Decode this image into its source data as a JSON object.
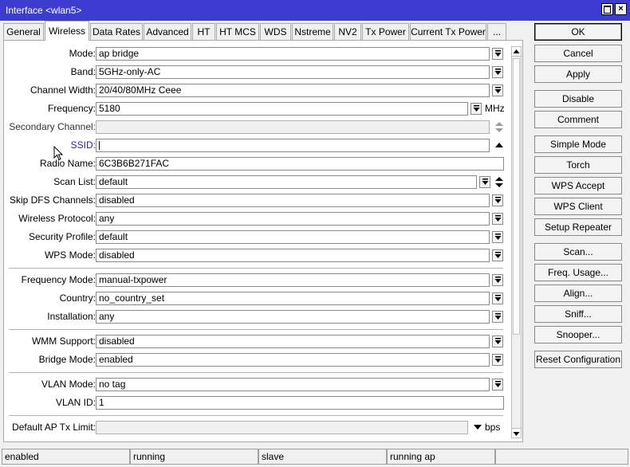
{
  "window": {
    "title": "Interface <wlan5>",
    "maximize_label": "",
    "close_label": "×",
    "titlebar_color": "#3c3cd0"
  },
  "tabs": [
    {
      "label": "General",
      "active": false
    },
    {
      "label": "Wireless",
      "active": true
    },
    {
      "label": "Data Rates",
      "active": false
    },
    {
      "label": "Advanced",
      "active": false
    },
    {
      "label": "HT",
      "active": false
    },
    {
      "label": "HT MCS",
      "active": false
    },
    {
      "label": "WDS",
      "active": false
    },
    {
      "label": "Nstreme",
      "active": false
    },
    {
      "label": "NV2",
      "active": false
    },
    {
      "label": "Tx Power",
      "active": false
    },
    {
      "label": "Current Tx Power",
      "active": false
    },
    {
      "label": "...",
      "active": false
    }
  ],
  "form": {
    "mode": {
      "label": "Mode:",
      "value": "ap bridge"
    },
    "band": {
      "label": "Band:",
      "value": "5GHz-only-AC"
    },
    "channel_width": {
      "label": "Channel Width:",
      "value": "20/40/80MHz Ceee"
    },
    "frequency": {
      "label": "Frequency:",
      "value": "5180",
      "unit": "MHz"
    },
    "secondary_channel": {
      "label": "Secondary Channel:",
      "value": ""
    },
    "ssid": {
      "label": "SSID:",
      "value": ""
    },
    "radio_name": {
      "label": "Radio Name:",
      "value": "6C3B6B271FAC"
    },
    "scan_list": {
      "label": "Scan List:",
      "value": "default"
    },
    "skip_dfs": {
      "label": "Skip DFS Channels:",
      "value": "disabled"
    },
    "wireless_protocol": {
      "label": "Wireless Protocol:",
      "value": "any"
    },
    "security_profile": {
      "label": "Security Profile:",
      "value": "default"
    },
    "wps_mode": {
      "label": "WPS Mode:",
      "value": "disabled"
    },
    "frequency_mode": {
      "label": "Frequency Mode:",
      "value": "manual-txpower"
    },
    "country": {
      "label": "Country:",
      "value": "no_country_set"
    },
    "installation": {
      "label": "Installation:",
      "value": "any"
    },
    "wmm_support": {
      "label": "WMM Support:",
      "value": "disabled"
    },
    "bridge_mode": {
      "label": "Bridge Mode:",
      "value": "enabled"
    },
    "vlan_mode": {
      "label": "VLAN Mode:",
      "value": "no tag"
    },
    "vlan_id": {
      "label": "VLAN ID:",
      "value": "1"
    },
    "default_ap_tx_limit": {
      "label": "Default AP Tx Limit:",
      "value": "",
      "unit": "bps"
    }
  },
  "buttons": [
    {
      "label": "OK"
    },
    {
      "label": "Cancel"
    },
    {
      "label": "Apply"
    },
    {
      "label": "Disable"
    },
    {
      "label": "Comment"
    },
    {
      "label": "Simple Mode"
    },
    {
      "label": "Torch"
    },
    {
      "label": "WPS Accept"
    },
    {
      "label": "WPS Client"
    },
    {
      "label": "Setup Repeater"
    },
    {
      "label": "Scan..."
    },
    {
      "label": "Freq. Usage..."
    },
    {
      "label": "Align..."
    },
    {
      "label": "Sniff..."
    },
    {
      "label": "Snooper..."
    },
    {
      "label": "Reset Configuration"
    }
  ],
  "status": [
    "enabled",
    "running",
    "slave",
    "running ap",
    ""
  ]
}
